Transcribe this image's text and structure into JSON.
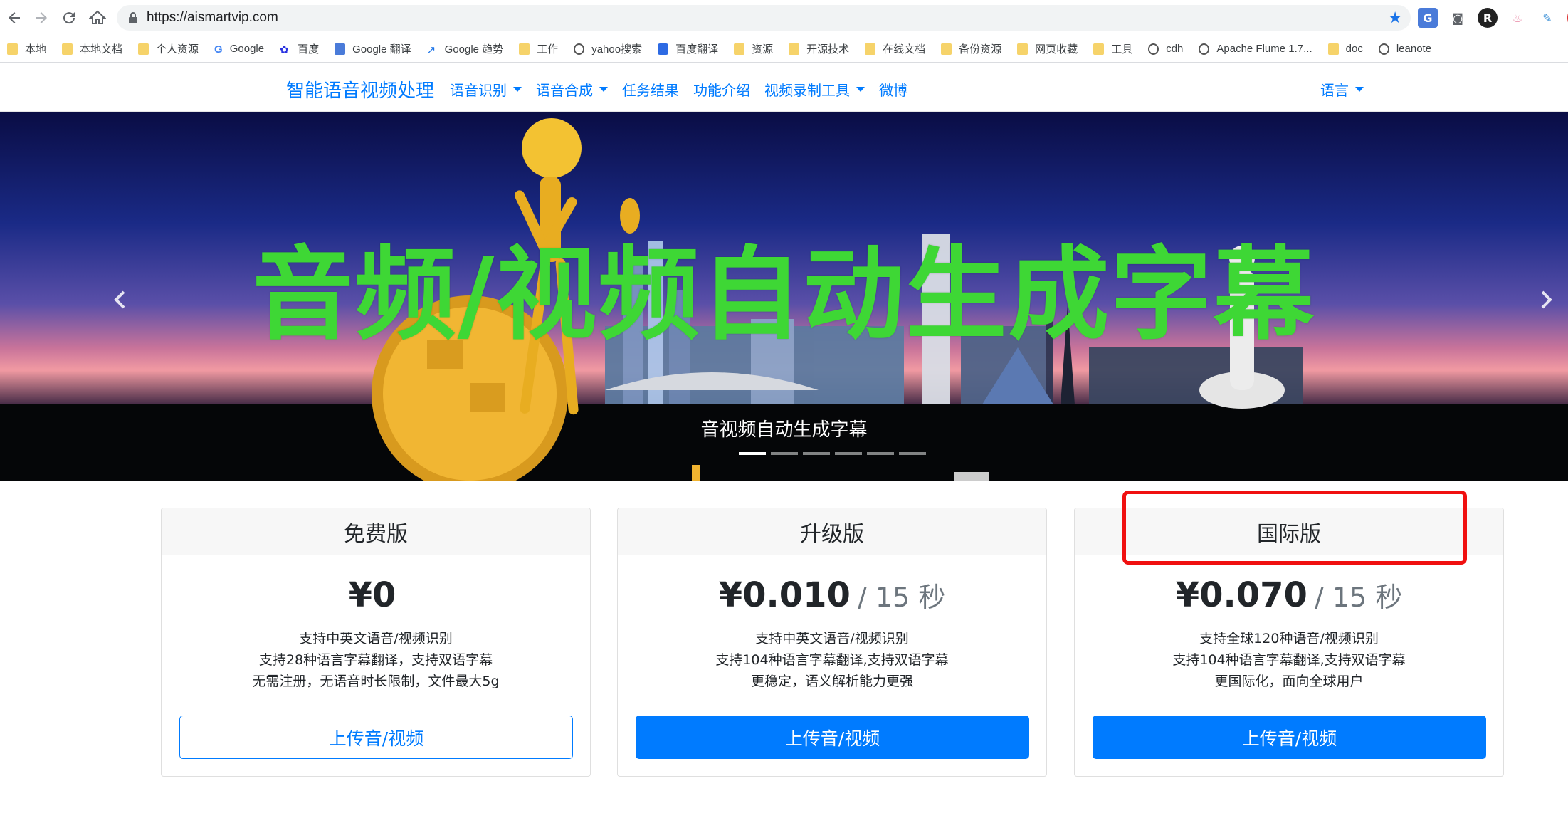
{
  "browser": {
    "url": "https://aismartvip.com",
    "bookmarks": [
      {
        "label": "本地",
        "icon": "folder-icon"
      },
      {
        "label": "本地文档",
        "icon": "folder-icon"
      },
      {
        "label": "个人资源",
        "icon": "folder-icon"
      },
      {
        "label": "Google",
        "icon": "google-icon"
      },
      {
        "label": "百度",
        "icon": "baidu-icon"
      },
      {
        "label": "Google 翻译",
        "icon": "translate-icon"
      },
      {
        "label": "Google 趋势",
        "icon": "trends-icon"
      },
      {
        "label": "工作",
        "icon": "folder-icon"
      },
      {
        "label": "yahoo搜索",
        "icon": "globe-icon"
      },
      {
        "label": "百度翻译",
        "icon": "baidu-translate-icon"
      },
      {
        "label": "资源",
        "icon": "folder-icon"
      },
      {
        "label": "开源技术",
        "icon": "folder-icon"
      },
      {
        "label": "在线文档",
        "icon": "folder-icon"
      },
      {
        "label": "备份资源",
        "icon": "folder-icon"
      },
      {
        "label": "网页收藏",
        "icon": "folder-icon"
      },
      {
        "label": "工具",
        "icon": "folder-icon"
      },
      {
        "label": "cdh",
        "icon": "globe-icon"
      },
      {
        "label": "Apache Flume 1.7...",
        "icon": "globe-icon"
      },
      {
        "label": "doc",
        "icon": "folder-icon"
      },
      {
        "label": "leanote",
        "icon": "globe-icon"
      }
    ]
  },
  "navbar": {
    "brand": "智能语音视频处理",
    "items": [
      {
        "label": "语音识别",
        "dropdown": true
      },
      {
        "label": "语音合成",
        "dropdown": true
      },
      {
        "label": "任务结果",
        "dropdown": false
      },
      {
        "label": "功能介绍",
        "dropdown": false
      },
      {
        "label": "视频录制工具",
        "dropdown": true
      },
      {
        "label": "微博",
        "dropdown": false
      }
    ],
    "language": "语言"
  },
  "carousel": {
    "title": "音频/视频自动生成字幕",
    "caption": "音视频自动生成字幕",
    "slide_count": 6,
    "active_index": 0
  },
  "plans": [
    {
      "name": "免费版",
      "price": "¥0",
      "unit": "",
      "features": [
        "支持中英文语音/视频识别",
        "支持28种语言字幕翻译，支持双语字幕",
        "无需注册，无语音时长限制，文件最大5g"
      ],
      "button": "上传音/视频",
      "style": "outline"
    },
    {
      "name": "升级版",
      "price": "¥0.010",
      "unit": "/ 15 秒",
      "features": [
        "支持中英文语音/视频识别",
        "支持104种语言字幕翻译,支持双语字幕",
        "更稳定，语义解析能力更强"
      ],
      "button": "上传音/视频",
      "style": "primary"
    },
    {
      "name": "国际版",
      "price": "¥0.070",
      "unit": "/ 15 秒",
      "features": [
        "支持全球120种语音/视频识别",
        "支持104种语言字幕翻译,支持双语字幕",
        "更国际化，面向全球用户"
      ],
      "button": "上传音/视频",
      "style": "primary"
    }
  ],
  "colors": {
    "primary": "#007bff",
    "banner_text": "#3ed735",
    "highlight": "#f01010"
  }
}
